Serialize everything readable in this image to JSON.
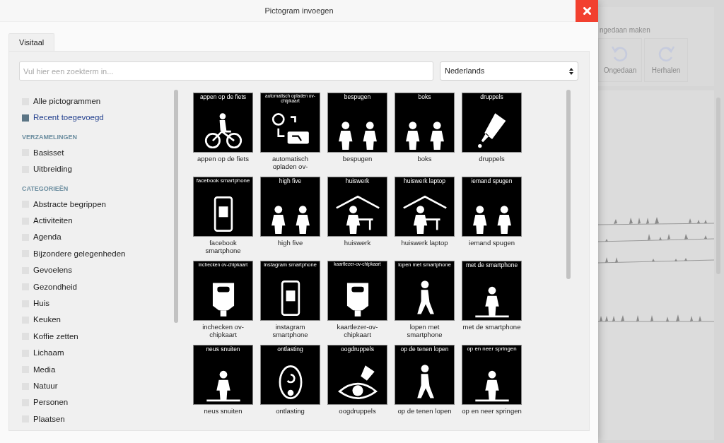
{
  "dialog": {
    "title": "Pictogram invoegen"
  },
  "tabs": [
    {
      "label": "Visitaal",
      "selected": true
    }
  ],
  "search": {
    "placeholder": "Vul hier een zoekterm in..."
  },
  "language_select": {
    "value": "Nederlands"
  },
  "sidebar": [
    {
      "items": [
        {
          "label": "Alle pictogrammen",
          "selected": false
        },
        {
          "label": "Recent toegevoegd",
          "selected": true
        }
      ]
    },
    {
      "heading": "VERZAMELINGEN",
      "items": [
        {
          "label": "Basisset",
          "selected": false
        },
        {
          "label": "Uitbreiding",
          "selected": false
        }
      ]
    },
    {
      "heading": "CATEGORIEËN",
      "items": [
        {
          "label": "Abstracte begrippen",
          "selected": false
        },
        {
          "label": "Activiteiten",
          "selected": false
        },
        {
          "label": "Agenda",
          "selected": false
        },
        {
          "label": "Bijzondere gelegenheden",
          "selected": false
        },
        {
          "label": "Gevoelens",
          "selected": false
        },
        {
          "label": "Gezondheid",
          "selected": false
        },
        {
          "label": "Huis",
          "selected": false
        },
        {
          "label": "Keuken",
          "selected": false
        },
        {
          "label": "Koffie zetten",
          "selected": false
        },
        {
          "label": "Lichaam",
          "selected": false
        },
        {
          "label": "Media",
          "selected": false
        },
        {
          "label": "Natuur",
          "selected": false
        },
        {
          "label": "Personen",
          "selected": false
        },
        {
          "label": "Plaatsen",
          "selected": false
        }
      ]
    }
  ],
  "pictograms": [
    {
      "title": "appen op de fiets",
      "label": "appen op de fiets"
    },
    {
      "title": "automatisch opladen ov-chipkaart",
      "label": "automatisch opladen ov-"
    },
    {
      "title": "bespugen",
      "label": "bespugen"
    },
    {
      "title": "boks",
      "label": "boks"
    },
    {
      "title": "druppels",
      "label": "druppels"
    },
    {
      "title": "facebook smartphone",
      "label": "facebook smartphone"
    },
    {
      "title": "high five",
      "label": "high five"
    },
    {
      "title": "huiswerk",
      "label": "huiswerk"
    },
    {
      "title": "huiswerk laptop",
      "label": "huiswerk laptop"
    },
    {
      "title": "iemand spugen",
      "label": "iemand spugen"
    },
    {
      "title": "inchecken ov-chipkaart",
      "label": "inchecken ov-chipkaart"
    },
    {
      "title": "instagram smartphone",
      "label": "instagram smartphone"
    },
    {
      "title": "kaartlezer-ov-chipkaart",
      "label": "kaartlezer-ov-chipkaart"
    },
    {
      "title": "lopen met smartphone",
      "label": "lopen met smartphone"
    },
    {
      "title": "met de smartphone",
      "label": "met de smartphone"
    },
    {
      "title": "neus snuiten",
      "label": "neus snuiten"
    },
    {
      "title": "ontlasting",
      "label": "ontlasting"
    },
    {
      "title": "oogdruppels",
      "label": "oogdruppels"
    },
    {
      "title": "op de tenen lopen",
      "label": "op de tenen lopen"
    },
    {
      "title": "op en neer springen",
      "label": "op en neer springen"
    }
  ],
  "background": {
    "group_title": "ngedaan maken",
    "buttons": [
      {
        "label": "Ongedaan",
        "kind": "undo"
      },
      {
        "label": "Herhalen",
        "kind": "redo"
      }
    ]
  }
}
